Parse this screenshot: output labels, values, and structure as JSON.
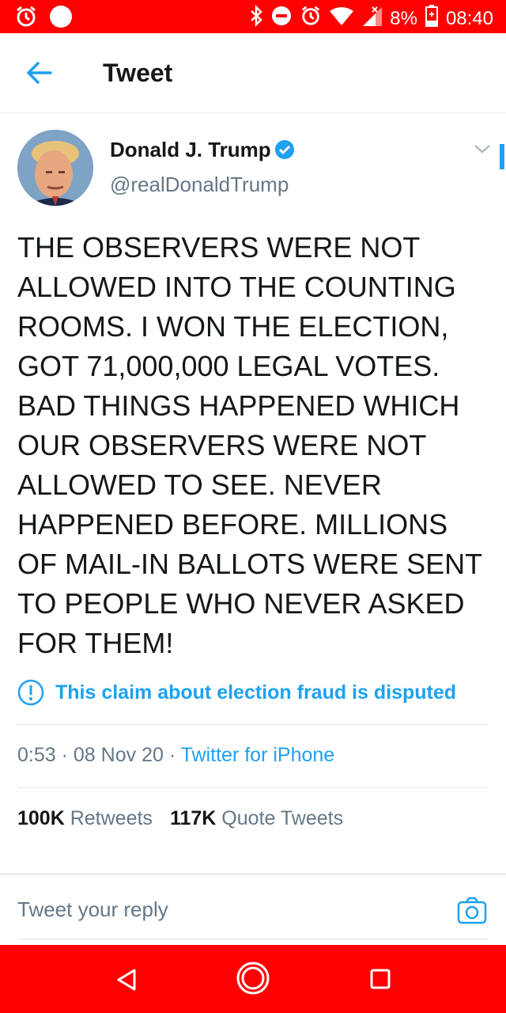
{
  "status_bar": {
    "battery_percent": "8%",
    "time": "08:40",
    "icons": [
      "alarm-icon",
      "notification-dot-icon",
      "bluetooth-icon",
      "do-not-disturb-icon",
      "alarm-icon",
      "wifi-icon",
      "signal-icon",
      "battery-charging-icon"
    ]
  },
  "header": {
    "title": "Tweet"
  },
  "tweet": {
    "author_name": "Donald J. Trump",
    "handle": "@realDonaldTrump",
    "text": "THE OBSERVERS WERE NOT\nALLOWED INTO THE COUNTING\nROOMS. I WON THE ELECTION,\nGOT 71,000,000 LEGAL VOTES.\nBAD THINGS HAPPENED WHICH\nOUR OBSERVERS WERE NOT\nALLOWED TO SEE. NEVER\nHAPPENED BEFORE. MILLIONS\nOF MAIL-IN BALLOTS WERE SENT\nTO PEOPLE WHO NEVER ASKED\nFOR THEM!",
    "disputed_notice": "This claim about election fraud is disputed",
    "time": "0:53",
    "date": "08 Nov 20",
    "source": "Twitter for iPhone",
    "retweets_count": "100K",
    "retweets_label": "Retweets",
    "quotes_count": "117K",
    "quotes_label": "Quote Tweets"
  },
  "reply": {
    "placeholder": "Tweet your reply"
  },
  "colors": {
    "accent": "#1da1f2",
    "status_bar": "#ff0000",
    "secondary_text": "#657786"
  }
}
